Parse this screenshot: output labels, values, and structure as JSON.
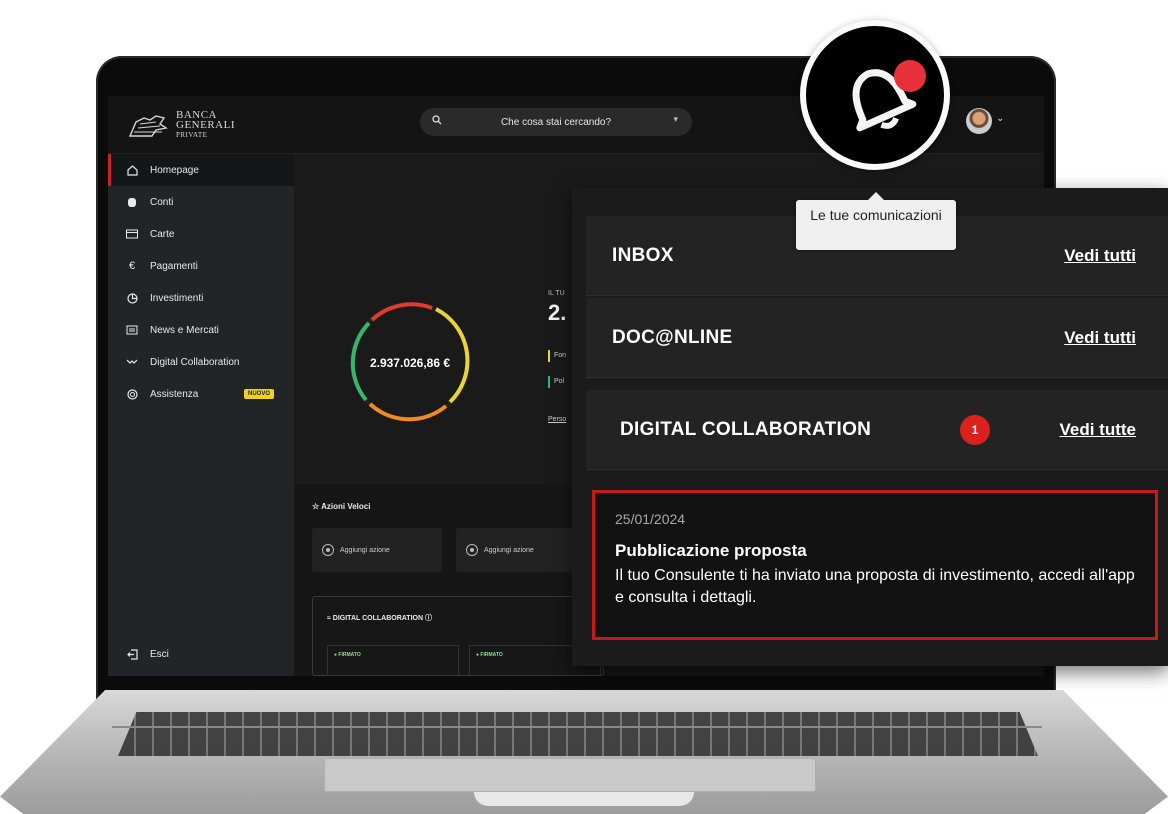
{
  "brand": {
    "name_line1": "BANCA",
    "name_line2": "GENERALI",
    "name_line3": "PRIVATE"
  },
  "search": {
    "placeholder": "Che cosa stai cercando?"
  },
  "sidebar": {
    "items": [
      {
        "label": "Homepage",
        "icon": "home-icon"
      },
      {
        "label": "Conti",
        "icon": "database-icon"
      },
      {
        "label": "Carte",
        "icon": "card-icon"
      },
      {
        "label": "Pagamenti",
        "icon": "euro-icon"
      },
      {
        "label": "Investimenti",
        "icon": "pie-chart-icon"
      },
      {
        "label": "News e Mercati",
        "icon": "newspaper-icon"
      },
      {
        "label": "Digital Collaboration",
        "icon": "collaboration-icon"
      },
      {
        "label": "Assistenza",
        "icon": "lifebuoy-icon",
        "badge": "NUOVO"
      }
    ],
    "exit_label": "Esci"
  },
  "hero": {
    "total": "2.937.026,86 €",
    "label": "IL TU",
    "big_value": "2.",
    "legend": [
      "Fon",
      "Pol"
    ],
    "link": "Perso"
  },
  "quick_actions": {
    "title": "☆ Azioni Veloci",
    "cards": [
      "Aggiungi azione",
      "Aggiungi azione"
    ]
  },
  "digital_collaboration_panel": {
    "title": "DIGITAL COLLABORATION",
    "cards": [
      {
        "status": "● FIRMATO"
      },
      {
        "status": "● FIRMATO"
      }
    ]
  },
  "notifications": {
    "tooltip": "Le tue comunicazioni",
    "rows": [
      {
        "label": "INBOX",
        "link": "Vedi tutti"
      },
      {
        "label": "DOC@NLINE",
        "link": "Vedi tutti"
      },
      {
        "label": "DIGITAL COLLABORATION",
        "count": "1",
        "link": "Vedi tutte"
      }
    ],
    "item": {
      "date": "25/01/2024",
      "title": "Pubblicazione proposta",
      "body": "Il tuo Consulente ti ha inviato una proposta di investimento, accedi all'app e consulta i dettagli."
    }
  },
  "colors": {
    "accent_red": "#c41a1a",
    "badge_red": "#d9221c",
    "notification_dot": "#e8303a",
    "new_badge": "#f0d21c",
    "donut_segments": [
      "#e23c2b",
      "#e8d33a",
      "#f08a24",
      "#35b86a"
    ]
  }
}
